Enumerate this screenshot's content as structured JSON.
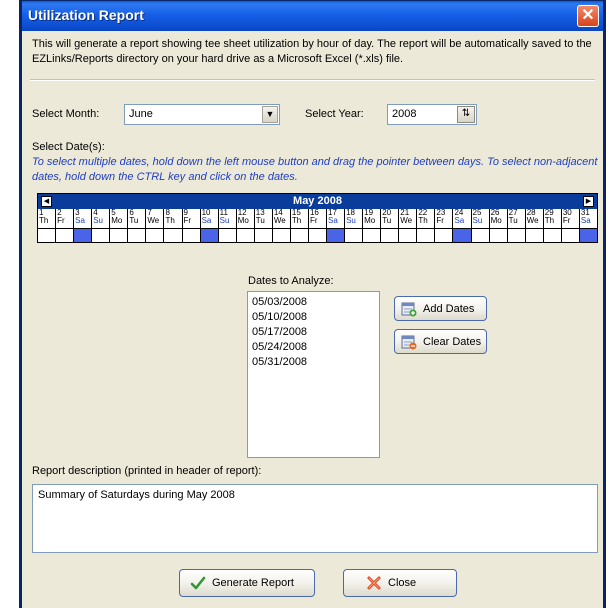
{
  "window": {
    "title": "Utilization Report",
    "close_glyph": "✕"
  },
  "description": "This will generate a report showing tee sheet utilization by hour of day.  The report will be automatically saved to the EZLinks/Reports directory on your hard drive as a Microsoft Excel (*.xls) file.",
  "month": {
    "label": "Select Month:",
    "value": "June"
  },
  "year": {
    "label": "Select Year:",
    "value": "2008"
  },
  "dates": {
    "label": "Select Date(s):",
    "hint": "To select multiple dates, hold down the left mouse button and drag the pointer between days.  To select non-adjacent dates, hold down the CTRL key and click on the dates."
  },
  "calendar": {
    "month_title": "May 2008",
    "prev_icon": "left-arrow-icon",
    "next_icon": "right-arrow-icon",
    "selection_color": "#4a64e8",
    "days": [
      {
        "n": "1",
        "wd": "Th"
      },
      {
        "n": "2",
        "wd": "Fr"
      },
      {
        "n": "3",
        "wd": "Sa",
        "sel": true
      },
      {
        "n": "4",
        "wd": "Su"
      },
      {
        "n": "5",
        "wd": "Mo"
      },
      {
        "n": "6",
        "wd": "Tu"
      },
      {
        "n": "7",
        "wd": "We"
      },
      {
        "n": "8",
        "wd": "Th"
      },
      {
        "n": "9",
        "wd": "Fr"
      },
      {
        "n": "10",
        "wd": "Sa",
        "sel": true
      },
      {
        "n": "11",
        "wd": "Su"
      },
      {
        "n": "12",
        "wd": "Mo"
      },
      {
        "n": "13",
        "wd": "Tu"
      },
      {
        "n": "14",
        "wd": "We"
      },
      {
        "n": "15",
        "wd": "Th"
      },
      {
        "n": "16",
        "wd": "Fr"
      },
      {
        "n": "17",
        "wd": "Sa",
        "sel": true
      },
      {
        "n": "18",
        "wd": "Su"
      },
      {
        "n": "19",
        "wd": "Mo"
      },
      {
        "n": "20",
        "wd": "Tu"
      },
      {
        "n": "21",
        "wd": "We"
      },
      {
        "n": "22",
        "wd": "Th"
      },
      {
        "n": "23",
        "wd": "Fr"
      },
      {
        "n": "24",
        "wd": "Sa",
        "sel": true
      },
      {
        "n": "25",
        "wd": "Su"
      },
      {
        "n": "26",
        "wd": "Mo"
      },
      {
        "n": "27",
        "wd": "Tu"
      },
      {
        "n": "28",
        "wd": "We"
      },
      {
        "n": "29",
        "wd": "Th"
      },
      {
        "n": "30",
        "wd": "Fr"
      },
      {
        "n": "31",
        "wd": "Sa",
        "sel": true
      }
    ]
  },
  "analyze": {
    "label": "Dates to Analyze:",
    "items": [
      "05/03/2008",
      "05/10/2008",
      "05/17/2008",
      "05/24/2008",
      "05/31/2008"
    ]
  },
  "buttons": {
    "add_dates": "Add Dates",
    "clear_dates": "Clear Dates",
    "generate": "Generate Report",
    "close": "Close"
  },
  "report": {
    "label": "Report description (printed in header of report):",
    "value": "Summary of Saturdays during May 2008"
  },
  "colors": {
    "title_bar": "#0b4ccc",
    "weekend_text": "#1f3fbf",
    "hint_text": "#1f3fbf"
  }
}
